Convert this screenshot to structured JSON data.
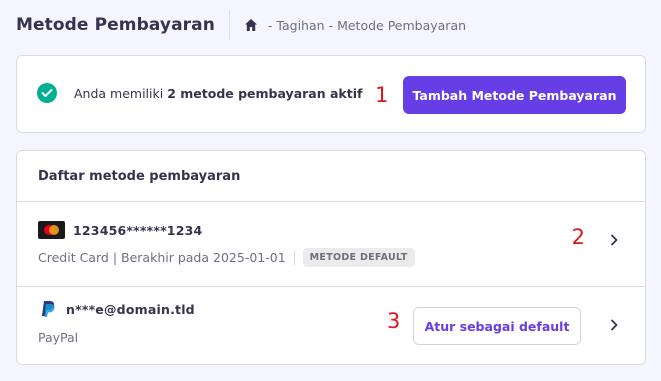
{
  "header": {
    "title": "Metode Pembayaran",
    "breadcrumb": [
      "Tagihan",
      "Metode Pembayaran"
    ],
    "breadcrumb_separator": "-"
  },
  "status": {
    "text_prefix": "Anda memiliki ",
    "text_bold": "2 metode pembayaran aktif",
    "add_button_label": "Tambah Metode Pembayaran"
  },
  "annotations": [
    "1",
    "2",
    "3"
  ],
  "payment_list": {
    "title": "Daftar metode pembayaran",
    "items": [
      {
        "icon": "mastercard-icon",
        "name": "123456******1234",
        "type": "Credit Card",
        "detail": "Berakhir pada 2025-01-01",
        "badge": "METODE DEFAULT"
      },
      {
        "icon": "paypal-icon",
        "name": "n***e@domain.tld",
        "type": "PayPal",
        "action_label": "Atur sebagai default"
      }
    ]
  },
  "colors": {
    "primary": "#673de6",
    "success": "#00b090",
    "annotation": "#e0161c",
    "background": "#f4f5ff"
  }
}
